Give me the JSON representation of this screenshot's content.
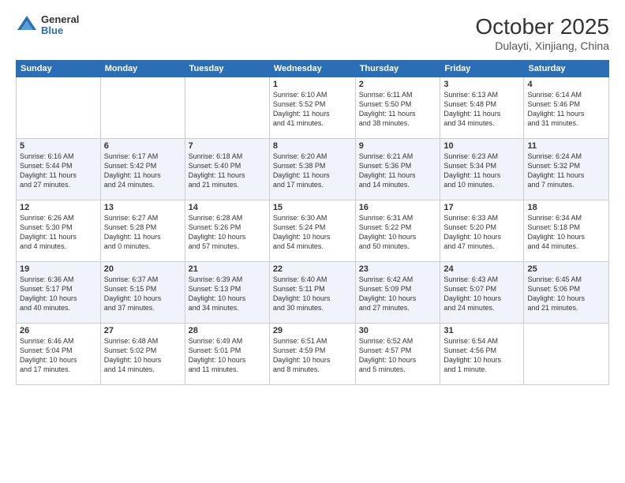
{
  "logo": {
    "general": "General",
    "blue": "Blue"
  },
  "title": "October 2025",
  "subtitle": "Dulayti, Xinjiang, China",
  "days_header": [
    "Sunday",
    "Monday",
    "Tuesday",
    "Wednesday",
    "Thursday",
    "Friday",
    "Saturday"
  ],
  "weeks": [
    [
      {
        "num": "",
        "info": ""
      },
      {
        "num": "",
        "info": ""
      },
      {
        "num": "",
        "info": ""
      },
      {
        "num": "1",
        "info": "Sunrise: 6:10 AM\nSunset: 5:52 PM\nDaylight: 11 hours\nand 41 minutes."
      },
      {
        "num": "2",
        "info": "Sunrise: 6:11 AM\nSunset: 5:50 PM\nDaylight: 11 hours\nand 38 minutes."
      },
      {
        "num": "3",
        "info": "Sunrise: 6:13 AM\nSunset: 5:48 PM\nDaylight: 11 hours\nand 34 minutes."
      },
      {
        "num": "4",
        "info": "Sunrise: 6:14 AM\nSunset: 5:46 PM\nDaylight: 11 hours\nand 31 minutes."
      }
    ],
    [
      {
        "num": "5",
        "info": "Sunrise: 6:16 AM\nSunset: 5:44 PM\nDaylight: 11 hours\nand 27 minutes."
      },
      {
        "num": "6",
        "info": "Sunrise: 6:17 AM\nSunset: 5:42 PM\nDaylight: 11 hours\nand 24 minutes."
      },
      {
        "num": "7",
        "info": "Sunrise: 6:18 AM\nSunset: 5:40 PM\nDaylight: 11 hours\nand 21 minutes."
      },
      {
        "num": "8",
        "info": "Sunrise: 6:20 AM\nSunset: 5:38 PM\nDaylight: 11 hours\nand 17 minutes."
      },
      {
        "num": "9",
        "info": "Sunrise: 6:21 AM\nSunset: 5:36 PM\nDaylight: 11 hours\nand 14 minutes."
      },
      {
        "num": "10",
        "info": "Sunrise: 6:23 AM\nSunset: 5:34 PM\nDaylight: 11 hours\nand 10 minutes."
      },
      {
        "num": "11",
        "info": "Sunrise: 6:24 AM\nSunset: 5:32 PM\nDaylight: 11 hours\nand 7 minutes."
      }
    ],
    [
      {
        "num": "12",
        "info": "Sunrise: 6:26 AM\nSunset: 5:30 PM\nDaylight: 11 hours\nand 4 minutes."
      },
      {
        "num": "13",
        "info": "Sunrise: 6:27 AM\nSunset: 5:28 PM\nDaylight: 11 hours\nand 0 minutes."
      },
      {
        "num": "14",
        "info": "Sunrise: 6:28 AM\nSunset: 5:26 PM\nDaylight: 10 hours\nand 57 minutes."
      },
      {
        "num": "15",
        "info": "Sunrise: 6:30 AM\nSunset: 5:24 PM\nDaylight: 10 hours\nand 54 minutes."
      },
      {
        "num": "16",
        "info": "Sunrise: 6:31 AM\nSunset: 5:22 PM\nDaylight: 10 hours\nand 50 minutes."
      },
      {
        "num": "17",
        "info": "Sunrise: 6:33 AM\nSunset: 5:20 PM\nDaylight: 10 hours\nand 47 minutes."
      },
      {
        "num": "18",
        "info": "Sunrise: 6:34 AM\nSunset: 5:18 PM\nDaylight: 10 hours\nand 44 minutes."
      }
    ],
    [
      {
        "num": "19",
        "info": "Sunrise: 6:36 AM\nSunset: 5:17 PM\nDaylight: 10 hours\nand 40 minutes."
      },
      {
        "num": "20",
        "info": "Sunrise: 6:37 AM\nSunset: 5:15 PM\nDaylight: 10 hours\nand 37 minutes."
      },
      {
        "num": "21",
        "info": "Sunrise: 6:39 AM\nSunset: 5:13 PM\nDaylight: 10 hours\nand 34 minutes."
      },
      {
        "num": "22",
        "info": "Sunrise: 6:40 AM\nSunset: 5:11 PM\nDaylight: 10 hours\nand 30 minutes."
      },
      {
        "num": "23",
        "info": "Sunrise: 6:42 AM\nSunset: 5:09 PM\nDaylight: 10 hours\nand 27 minutes."
      },
      {
        "num": "24",
        "info": "Sunrise: 6:43 AM\nSunset: 5:07 PM\nDaylight: 10 hours\nand 24 minutes."
      },
      {
        "num": "25",
        "info": "Sunrise: 6:45 AM\nSunset: 5:06 PM\nDaylight: 10 hours\nand 21 minutes."
      }
    ],
    [
      {
        "num": "26",
        "info": "Sunrise: 6:46 AM\nSunset: 5:04 PM\nDaylight: 10 hours\nand 17 minutes."
      },
      {
        "num": "27",
        "info": "Sunrise: 6:48 AM\nSunset: 5:02 PM\nDaylight: 10 hours\nand 14 minutes."
      },
      {
        "num": "28",
        "info": "Sunrise: 6:49 AM\nSunset: 5:01 PM\nDaylight: 10 hours\nand 11 minutes."
      },
      {
        "num": "29",
        "info": "Sunrise: 6:51 AM\nSunset: 4:59 PM\nDaylight: 10 hours\nand 8 minutes."
      },
      {
        "num": "30",
        "info": "Sunrise: 6:52 AM\nSunset: 4:57 PM\nDaylight: 10 hours\nand 5 minutes."
      },
      {
        "num": "31",
        "info": "Sunrise: 6:54 AM\nSunset: 4:56 PM\nDaylight: 10 hours\nand 1 minute."
      },
      {
        "num": "",
        "info": ""
      }
    ]
  ],
  "shaded_weeks": [
    1,
    3
  ]
}
